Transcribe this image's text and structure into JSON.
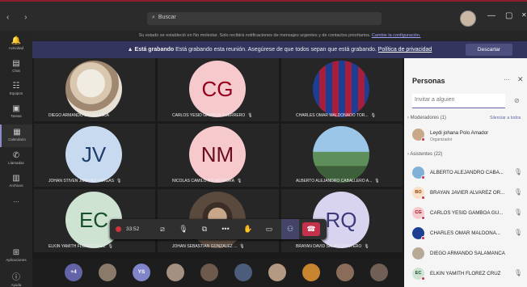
{
  "topbar": {
    "nav": "‹ ›",
    "search_placeholder": "Buscar",
    "window_controls": [
      "—",
      "▢",
      "✕"
    ]
  },
  "notice": {
    "text": "Su estado se estableció en No molestar. Solo recibirá notificaciones de mensajes urgentes y de contactos prioritarios.",
    "link": "Cambie la configuración."
  },
  "recording": {
    "label": "Está grabando",
    "text": "Está grabando esta reunión. Asegúrese de que todos sepan que está grabando.",
    "link": "Política de privacidad",
    "dismiss": "Descartar"
  },
  "rail": [
    {
      "label": "Actividad",
      "icon": "bell-icon"
    },
    {
      "label": "Chat",
      "icon": "chat-icon"
    },
    {
      "label": "Equipos",
      "icon": "teams-icon"
    },
    {
      "label": "Tareas",
      "icon": "tasks-icon"
    },
    {
      "label": "Calendario",
      "icon": "calendar-icon"
    },
    {
      "label": "Llamadas",
      "icon": "phone-icon"
    },
    {
      "label": "Archivos",
      "icon": "files-icon"
    },
    {
      "label": "...",
      "icon": "more-icon"
    },
    {
      "label": "Aplicaciones",
      "icon": "apps-icon"
    },
    {
      "label": "Ayuda",
      "icon": "help-icon"
    }
  ],
  "tiles": [
    {
      "initials": "",
      "name": "DIEGO ARMANDO SALAMANCA",
      "color": "#e8e2d6",
      "photo": true
    },
    {
      "initials": "CG",
      "name": "CARLOS YESID GAMBOA GUERRERO",
      "color": "#f6c9cc"
    },
    {
      "initials": "",
      "name": "CHARLES OMAR MALDONADO TOR...",
      "color": "#1c3f94",
      "photo": true
    },
    {
      "initials": "JV",
      "name": "JOHAN STIVEN JIMENEZ VARGAS",
      "color": "#c7daf0"
    },
    {
      "initials": "NM",
      "name": "NICOLAS CAMILO ROJAS MORA",
      "color": "#f6c9cc"
    },
    {
      "initials": "",
      "name": "ALBERTO ALEJANDRO CABALLERO A...",
      "color": "#7fb0d6",
      "photo": true
    },
    {
      "initials": "EC",
      "name": "ELKIN YAMITH FLOREZ CRUZ",
      "color": "#cfe3d2"
    },
    {
      "initials": "",
      "name": "JOHAN SEBASTIAN GONZALEZ ...",
      "color": "#5a4a3e",
      "photo": true
    },
    {
      "initials": "RQ",
      "name": "BRAYAN DAVID SALAS QUINTERO",
      "color": "#d8d4f0"
    }
  ],
  "controls": {
    "timer": "33:52"
  },
  "strip": [
    {
      "label": "+4",
      "color": "#6264a7"
    },
    {
      "label": "",
      "color": "#8a7a6a"
    },
    {
      "label": "YS",
      "color": "#7f85c8"
    },
    {
      "label": "",
      "color": "#a39080"
    },
    {
      "label": "",
      "color": "#6d5a4c"
    },
    {
      "label": "",
      "color": "#4b5d7a"
    },
    {
      "label": "",
      "color": "#b49a82"
    },
    {
      "label": "",
      "color": "#c8842f"
    },
    {
      "label": "",
      "color": "#8a6c5a"
    },
    {
      "label": "",
      "color": "#705f55"
    }
  ],
  "panel": {
    "title": "Personas",
    "invite_placeholder": "Invitar a alguien",
    "moderators_label": "Moderadores (1)",
    "mute_all": "Silenciar a todos",
    "organizer": {
      "name": "Leydi johana Polo Amador",
      "role": "Organizador"
    },
    "attendees_label": "Asistentes (22)",
    "attendees": [
      {
        "initials": "",
        "name": "ALBERTO ALEJANDRO CABA...",
        "color": "#7fb0d6"
      },
      {
        "initials": "BO",
        "name": "BRAYAN JAVIER ALVAREZ OR...",
        "color": "#fbe0c8"
      },
      {
        "initials": "CG",
        "name": "CARLOS YESID GAMBOA GU...",
        "color": "#f6c9cc"
      },
      {
        "initials": "",
        "name": "CHARLES OMAR MALDONA...",
        "color": "#1c3f94"
      },
      {
        "initials": "",
        "name": "DIEGO ARMANDO SALAMANCA",
        "color": "#b8a896"
      },
      {
        "initials": "EC",
        "name": "ELKIN YAMITH FLOREZ CRUZ",
        "color": "#cfe3d2"
      }
    ]
  }
}
